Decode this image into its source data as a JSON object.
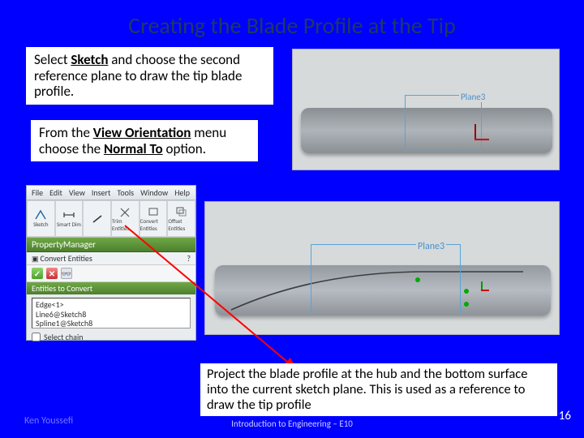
{
  "title": "Creating the Blade Profile at the Tip",
  "para1": {
    "pre": "Select ",
    "kw": "Sketch",
    "post": " and choose the second reference plane to draw the tip blade profile."
  },
  "para2": {
    "pre": "From the ",
    "kw1": "View Orientation",
    "mid": " menu choose the ",
    "kw2": "Normal To",
    "post": " option."
  },
  "para3": "Project the blade profile at the hub and the bottom surface into the current sketch plane. This is used as a reference to draw the tip profile",
  "cad": {
    "label1": "Plane3",
    "label2": "Plane3"
  },
  "toolbar": {
    "menus": [
      "File",
      "Edit",
      "View",
      "Insert",
      "Tools",
      "Window",
      "Help"
    ],
    "icon_labels": [
      "Sketch",
      "Smart Dim",
      "",
      "Trim Entities",
      "Convert Entities",
      "Offset Entities"
    ],
    "property_manager": "PropertyManager",
    "panel_title": "Convert Entities",
    "section": "Entities to Convert",
    "items": [
      "Edge<1>",
      "Line6@Sketch8",
      "Spline1@Sketch8"
    ],
    "select_chain": "Select chain"
  },
  "footer": {
    "left": "Ken Youssefi",
    "mid": "Introduction to Engineering – E10",
    "page": "16"
  }
}
